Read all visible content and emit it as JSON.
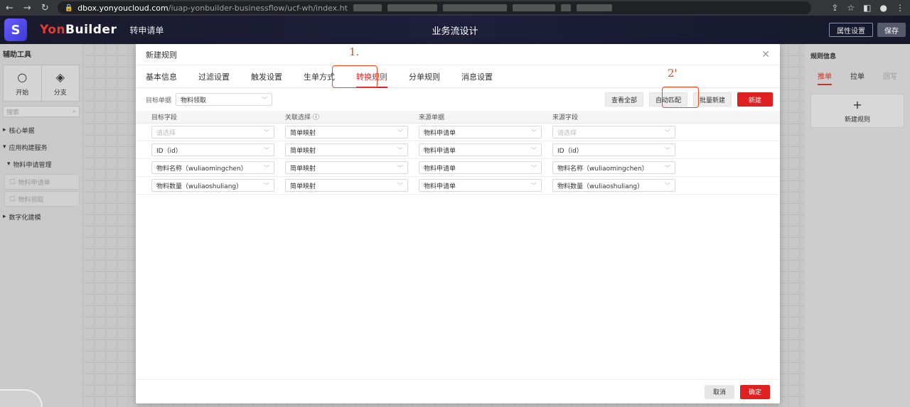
{
  "browser": {
    "url_host": "dbox.yonyoucloud.com",
    "url_path": "/iuap-yonbuilder-businessflow/ucf-wh/index.ht"
  },
  "header": {
    "logo_glyph": "S",
    "brand_yon": "Yon",
    "brand_builder": "Builder",
    "app_name": "转申请单",
    "title": "业务流设计",
    "btn_props": "属性设置",
    "btn_save": "保存"
  },
  "left": {
    "title": "辅助工具",
    "tools": [
      {
        "label": "开始"
      },
      {
        "label": "分支"
      }
    ],
    "search_placeholder": "搜索",
    "tree": {
      "core": "核心单据",
      "app_service": "应用构建服务",
      "material_mgmt": "物料申请管理",
      "leaf1": "物料申请单",
      "leaf2": "物料领取",
      "digital": "数字化建模"
    }
  },
  "right": {
    "title": "规则信息",
    "tabs": [
      "推单",
      "拉单",
      "回写"
    ],
    "new_rule": "新建规则"
  },
  "modal": {
    "title": "新建规则",
    "tabs": [
      "基本信息",
      "过滤设置",
      "触发设置",
      "生单方式",
      "转换规则",
      "分单规则",
      "消息设置"
    ],
    "active_tab": 4,
    "annotation1": "1.",
    "annotation2": "2'",
    "toolbar": {
      "target_label": "目标单据",
      "target_value": "物料领取",
      "view_all": "查看全部",
      "auto_match": "自动匹配",
      "batch_new": "批量新建",
      "new": "新建"
    },
    "columns": [
      "目标字段",
      "关联选择 ⓘ",
      "来源单据",
      "来源字段"
    ],
    "rows": [
      {
        "target": "请选择",
        "relation": "简单映射",
        "source_doc": "物料申请单",
        "source_field": "请选择"
      },
      {
        "target": "ID（id）",
        "relation": "简单映射",
        "source_doc": "物料申请单",
        "source_field": "ID（id）"
      },
      {
        "target": "物料名称（wuliaomingchen）",
        "relation": "简单映射",
        "source_doc": "物料申请单",
        "source_field": "物料名称（wuliaomingchen）"
      },
      {
        "target": "物料数量（wuliaoshuliang）",
        "relation": "简单映射",
        "source_doc": "物料申请单",
        "source_field": "物料数量（wuliaoshuliang）"
      }
    ],
    "footer": {
      "cancel": "取消",
      "ok": "确定"
    }
  },
  "colors": {
    "accent": "#e02020",
    "annotation": "#e8491d",
    "header_bg": "#1d1f3b"
  }
}
